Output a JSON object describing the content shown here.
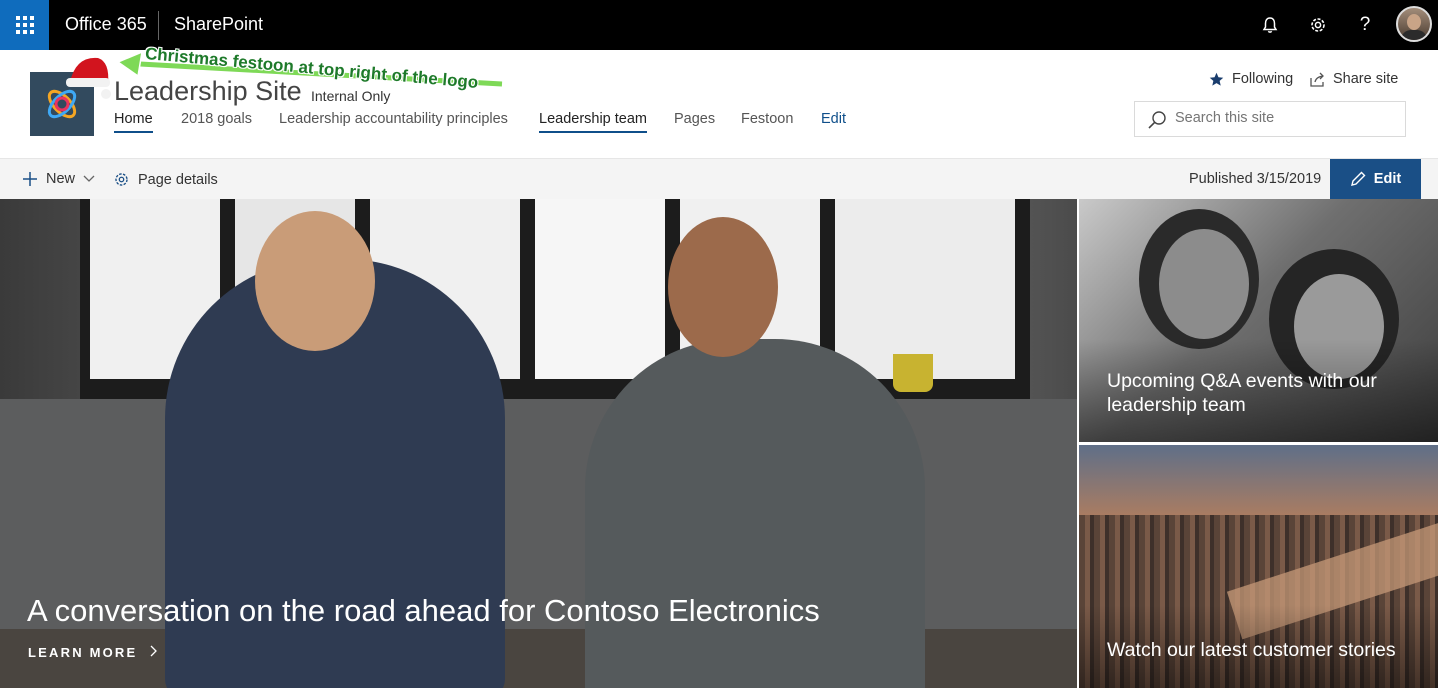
{
  "suitebar": {
    "app_name": "Office 365",
    "product_name": "SharePoint",
    "icons": [
      "app-launcher-icon",
      "bell-icon",
      "gear-icon",
      "help-icon"
    ],
    "help_glyph": "?",
    "bg_color": "#000000",
    "accent_color": "#0f6cbd"
  },
  "site": {
    "title": "Leadership Site",
    "classification": "Internal Only",
    "nav": [
      {
        "label": "Home",
        "active": true
      },
      {
        "label": "2018 goals"
      },
      {
        "label": "Leadership accountability principles"
      },
      {
        "label": "Leadership team",
        "active": true
      },
      {
        "label": "Pages"
      },
      {
        "label": "Festoon"
      },
      {
        "label": "Edit"
      }
    ],
    "following_label": "Following",
    "share_label": "Share site",
    "search_placeholder": "Search this site"
  },
  "annotation": {
    "text": "Christmas festoon at top right of the logo",
    "color": "#1e7a2a"
  },
  "commandbar": {
    "new_label": "New",
    "page_details_label": "Page details",
    "published": "Published 3/15/2019",
    "edit_label": "Edit",
    "edit_color": "#1a4f86"
  },
  "hero": {
    "main_title": "A conversation on the road ahead for Contoso Electronics",
    "learn_more": "LEARN MORE",
    "tile1_title": "Upcoming Q&A events with our leadership team",
    "tile2_title": "Watch our latest customer stories"
  }
}
